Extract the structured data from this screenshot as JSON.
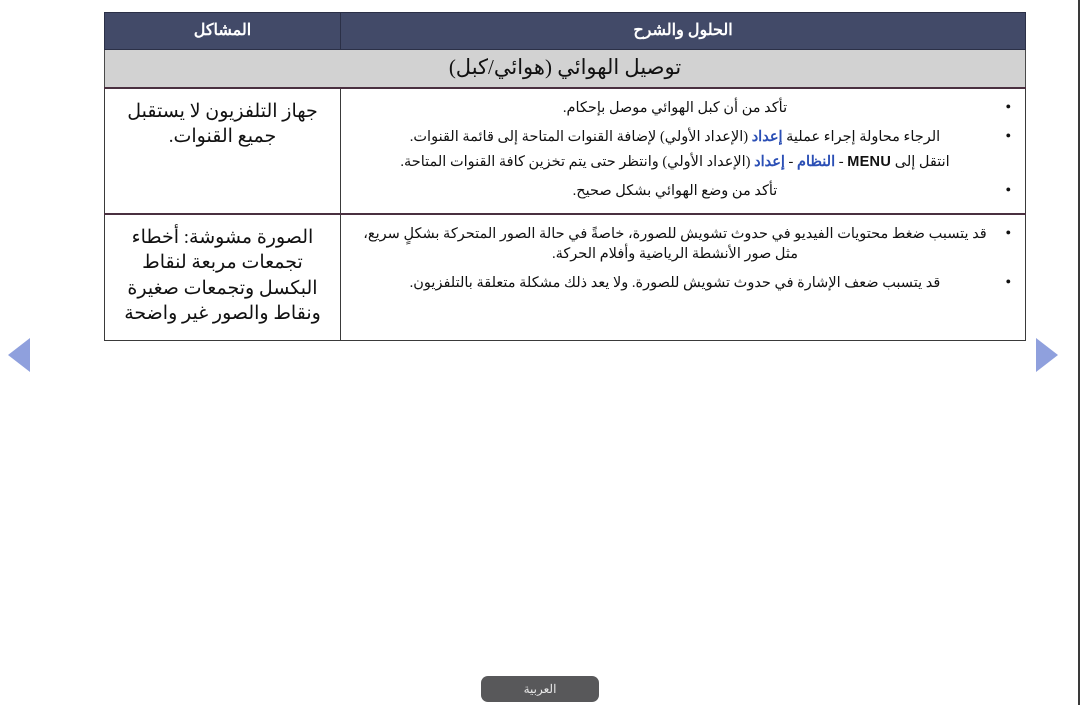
{
  "page": {
    "language_button_label": "العربية",
    "accent_arrow_color": "#8fa0dd",
    "header_bg_color": "#424a68",
    "section_band_color": "#d2d2d2",
    "link_color": "#2b4fb5"
  },
  "nav": {
    "prev_label": "السابق",
    "next_label": "التالي"
  },
  "table": {
    "headers": {
      "problem": "المشاكل",
      "solution": "الحلول والشرح"
    },
    "section_title": "توصيل الهوائي (هوائي/كبل)",
    "rows": [
      {
        "problem": "جهاز التلفزيون لا يستقبل جميع القنوات.",
        "bullets": [
          {
            "segments": [
              {
                "text": "تأكد من أن كبل الهوائي موصل بإحكام.",
                "style": "normal"
              }
            ]
          },
          {
            "segments": [
              {
                "text": "الرجاء محاولة إجراء عملية ",
                "style": "normal"
              },
              {
                "text": "إعداد",
                "style": "highlight"
              },
              {
                "text": " (الإعداد الأولي) لإضافة القنوات المتاحة إلى قائمة القنوات.",
                "style": "normal"
              }
            ]
          },
          {
            "segments": [
              {
                "text": "انتقل إلى ",
                "style": "normal"
              },
              {
                "text": "MENU",
                "style": "key"
              },
              {
                "text": " - ",
                "style": "normal"
              },
              {
                "text": "النظام",
                "style": "highlight"
              },
              {
                "text": " - ",
                "style": "normal"
              },
              {
                "text": "إعداد",
                "style": "highlight"
              },
              {
                "text": " (الإعداد الأولي) وانتظر حتى يتم تخزين كافة القنوات المتاحة.",
                "style": "normal"
              }
            ],
            "no_bullet": true
          },
          {
            "segments": [
              {
                "text": "تأكد من وضع الهوائي بشكل صحيح.",
                "style": "normal"
              }
            ]
          }
        ]
      },
      {
        "problem": "الصورة مشوشة: أخطاء تجمعات مربعة لنقاط البكسل وتجمعات صغيرة ونقاط والصور غير واضحة",
        "bullets": [
          {
            "segments": [
              {
                "text": "قد يتسبب ضغط محتويات الفيديو في حدوث تشويش للصورة، خاصةً في حالة الصور المتحركة بشكلٍ سريع، مثل صور الأنشطة الرياضية وأفلام الحركة.",
                "style": "normal"
              }
            ]
          },
          {
            "segments": [
              {
                "text": "قد يتسبب ضعف الإشارة في حدوث تشويش للصورة. ولا يعد ذلك مشكلة متعلقة بالتلفزيون.",
                "style": "normal"
              }
            ]
          }
        ]
      }
    ]
  }
}
